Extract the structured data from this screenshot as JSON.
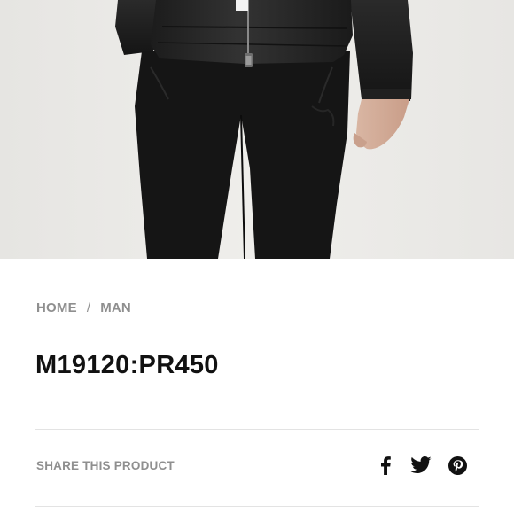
{
  "breadcrumb": {
    "home": "HOME",
    "separator": "/",
    "current": "MAN"
  },
  "product": {
    "title": "M19120:PR450"
  },
  "share": {
    "label": "SHARE THIS PRODUCT",
    "icons": [
      "facebook-icon",
      "twitter-icon",
      "pinterest-icon"
    ]
  },
  "colors": {
    "text_dark": "#111111",
    "text_muted": "#8f8f8f",
    "divider": "#e3e3e3",
    "photo_bg": "#ecebe8"
  }
}
